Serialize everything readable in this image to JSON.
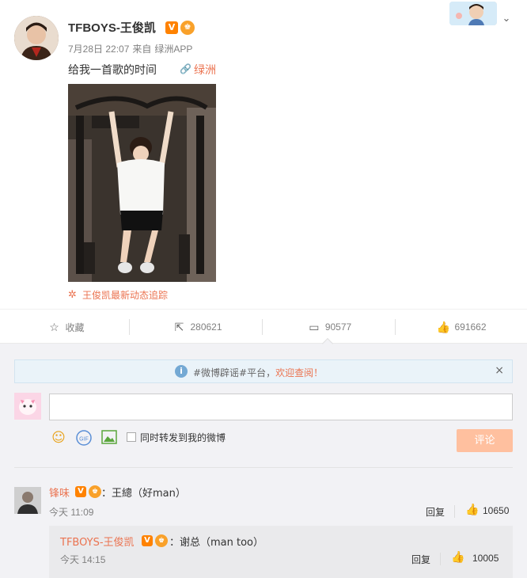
{
  "post": {
    "author": "TFBOYS-王俊凯",
    "verified_badge": "V",
    "date": "7月28日 22:07",
    "source_prefix": "来自",
    "source": "绿洲APP",
    "text": "给我一首歌的时间",
    "location_icon": "link-icon",
    "location": "绿洲",
    "topic_icon": "topic-icon",
    "topic": "王俊凯最新动态追踪"
  },
  "actions": {
    "favorite_label": "收藏",
    "repost_count": "280621",
    "comment_count": "90577",
    "like_count": "691662"
  },
  "notice": {
    "text_before": "#微博辟谣#平台，",
    "text_highlight": "欢迎查阅！",
    "close": "×"
  },
  "composer": {
    "placeholder": "",
    "repost_option": "同时转发到我的微博",
    "submit_label": "评论"
  },
  "comments": [
    {
      "name": "锋味",
      "text": "：王總（好man）",
      "time": "今天 11:09",
      "reply_label": "回复",
      "likes": "10650"
    }
  ],
  "replies": [
    {
      "name": "TFBOYS-王俊凯",
      "text": "：谢总（man too）",
      "time": "今天 14:15",
      "reply_label": "回复",
      "likes": "10005"
    }
  ],
  "colors": {
    "accent": "#eb7350",
    "submit_disabled": "#ffc09f",
    "panel_bg": "#f2f2f5",
    "notice_bg": "#eaf3f9"
  }
}
